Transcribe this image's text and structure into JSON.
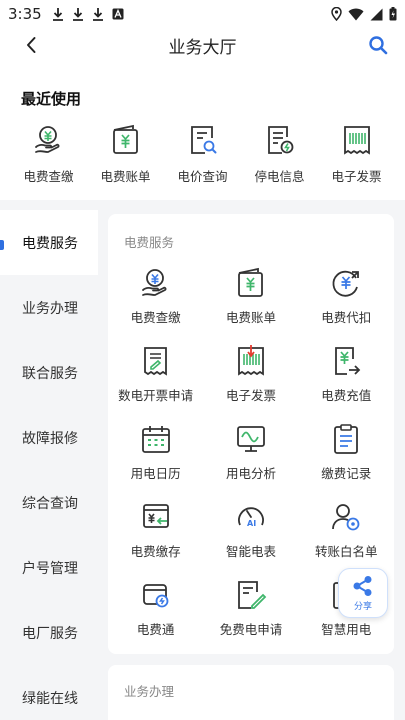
{
  "status_bar": {
    "time": "3:35"
  },
  "header": {
    "title": "业务大厅"
  },
  "recent": {
    "title": "最近使用",
    "items": [
      {
        "label": "电费查缴",
        "icon": "hand-yuan-icon"
      },
      {
        "label": "电费账单",
        "icon": "wallet-yuan-icon"
      },
      {
        "label": "电价查询",
        "icon": "doc-search-icon"
      },
      {
        "label": "停电信息",
        "icon": "doc-bolt-icon"
      },
      {
        "label": "电子发票",
        "icon": "receipt-barcode-icon"
      }
    ]
  },
  "sidebar": {
    "items": [
      {
        "label": "电费服务",
        "active": true
      },
      {
        "label": "业务办理"
      },
      {
        "label": "联合服务"
      },
      {
        "label": "故障报修"
      },
      {
        "label": "综合查询"
      },
      {
        "label": "户号管理"
      },
      {
        "label": "电厂服务"
      },
      {
        "label": "绿能在线"
      }
    ]
  },
  "main": {
    "section1_title": "电费服务",
    "section2_title": "业务办理",
    "grid": [
      {
        "label": "电费查缴",
        "icon": "hand-yuan-icon"
      },
      {
        "label": "电费账单",
        "icon": "wallet-yuan-icon"
      },
      {
        "label": "电费代扣",
        "icon": "yuan-refresh-icon"
      },
      {
        "label": "数电开票申请",
        "icon": "invoice-pen-icon"
      },
      {
        "label": "电子发票",
        "icon": "receipt-barcode-icon"
      },
      {
        "label": "电费充值",
        "icon": "phone-yuan-icon"
      },
      {
        "label": "用电日历",
        "icon": "calendar-icon"
      },
      {
        "label": "用电分析",
        "icon": "monitor-wave-icon"
      },
      {
        "label": "缴费记录",
        "icon": "clipboard-list-icon"
      },
      {
        "label": "电费缴存",
        "icon": "card-yuan-icon"
      },
      {
        "label": "智能电表",
        "icon": "gauge-ai-icon"
      },
      {
        "label": "转账白名单",
        "icon": "user-gear-icon"
      },
      {
        "label": "电费通",
        "icon": "card-badge-icon"
      },
      {
        "label": "免费电申请",
        "icon": "doc-edit-icon"
      },
      {
        "label": "智慧用电",
        "icon": "smart-power-icon"
      }
    ]
  },
  "share": {
    "label": "分享"
  },
  "colors": {
    "accent": "#2f6fe0",
    "icon_stroke": "#333333",
    "icon_green": "#3fb66b",
    "icon_blue": "#3a79e6",
    "icon_red": "#e33b2f"
  }
}
